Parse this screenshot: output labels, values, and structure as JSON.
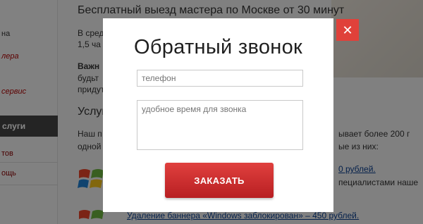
{
  "background": {
    "sidebar": {
      "fragments": [
        "на",
        "лера",
        "сервис"
      ],
      "section_label": "слуги",
      "menu_items": [
        "тов",
        "ощь"
      ]
    },
    "content": {
      "headline": "Бесплатный выезд мастера по Москве от 30 минут",
      "para1_line1": "В сред",
      "para1_line2": "1,5 ча",
      "important": "Важн",
      "para2_line1": "будьт",
      "para2_line2": "придут",
      "services_title": "Услуг",
      "services_left1": "Наш п",
      "services_left2": "одной",
      "services_right1": "ывает более 200 г",
      "services_right2": "ые из них:",
      "price_link": "0 рублей.",
      "specialists": "пециалистами наше",
      "banner_removal": "Удаление баннера «Windows заблокирован» – 450 рублей."
    }
  },
  "modal": {
    "title": "Обратный звонок",
    "phone_placeholder": "телефон",
    "time_placeholder": "удобное время для звонка",
    "submit_label": "ЗАКАЗАТЬ",
    "close_symbol": "✕"
  },
  "colors": {
    "button": "#d0302f",
    "close": "#e0413a"
  }
}
